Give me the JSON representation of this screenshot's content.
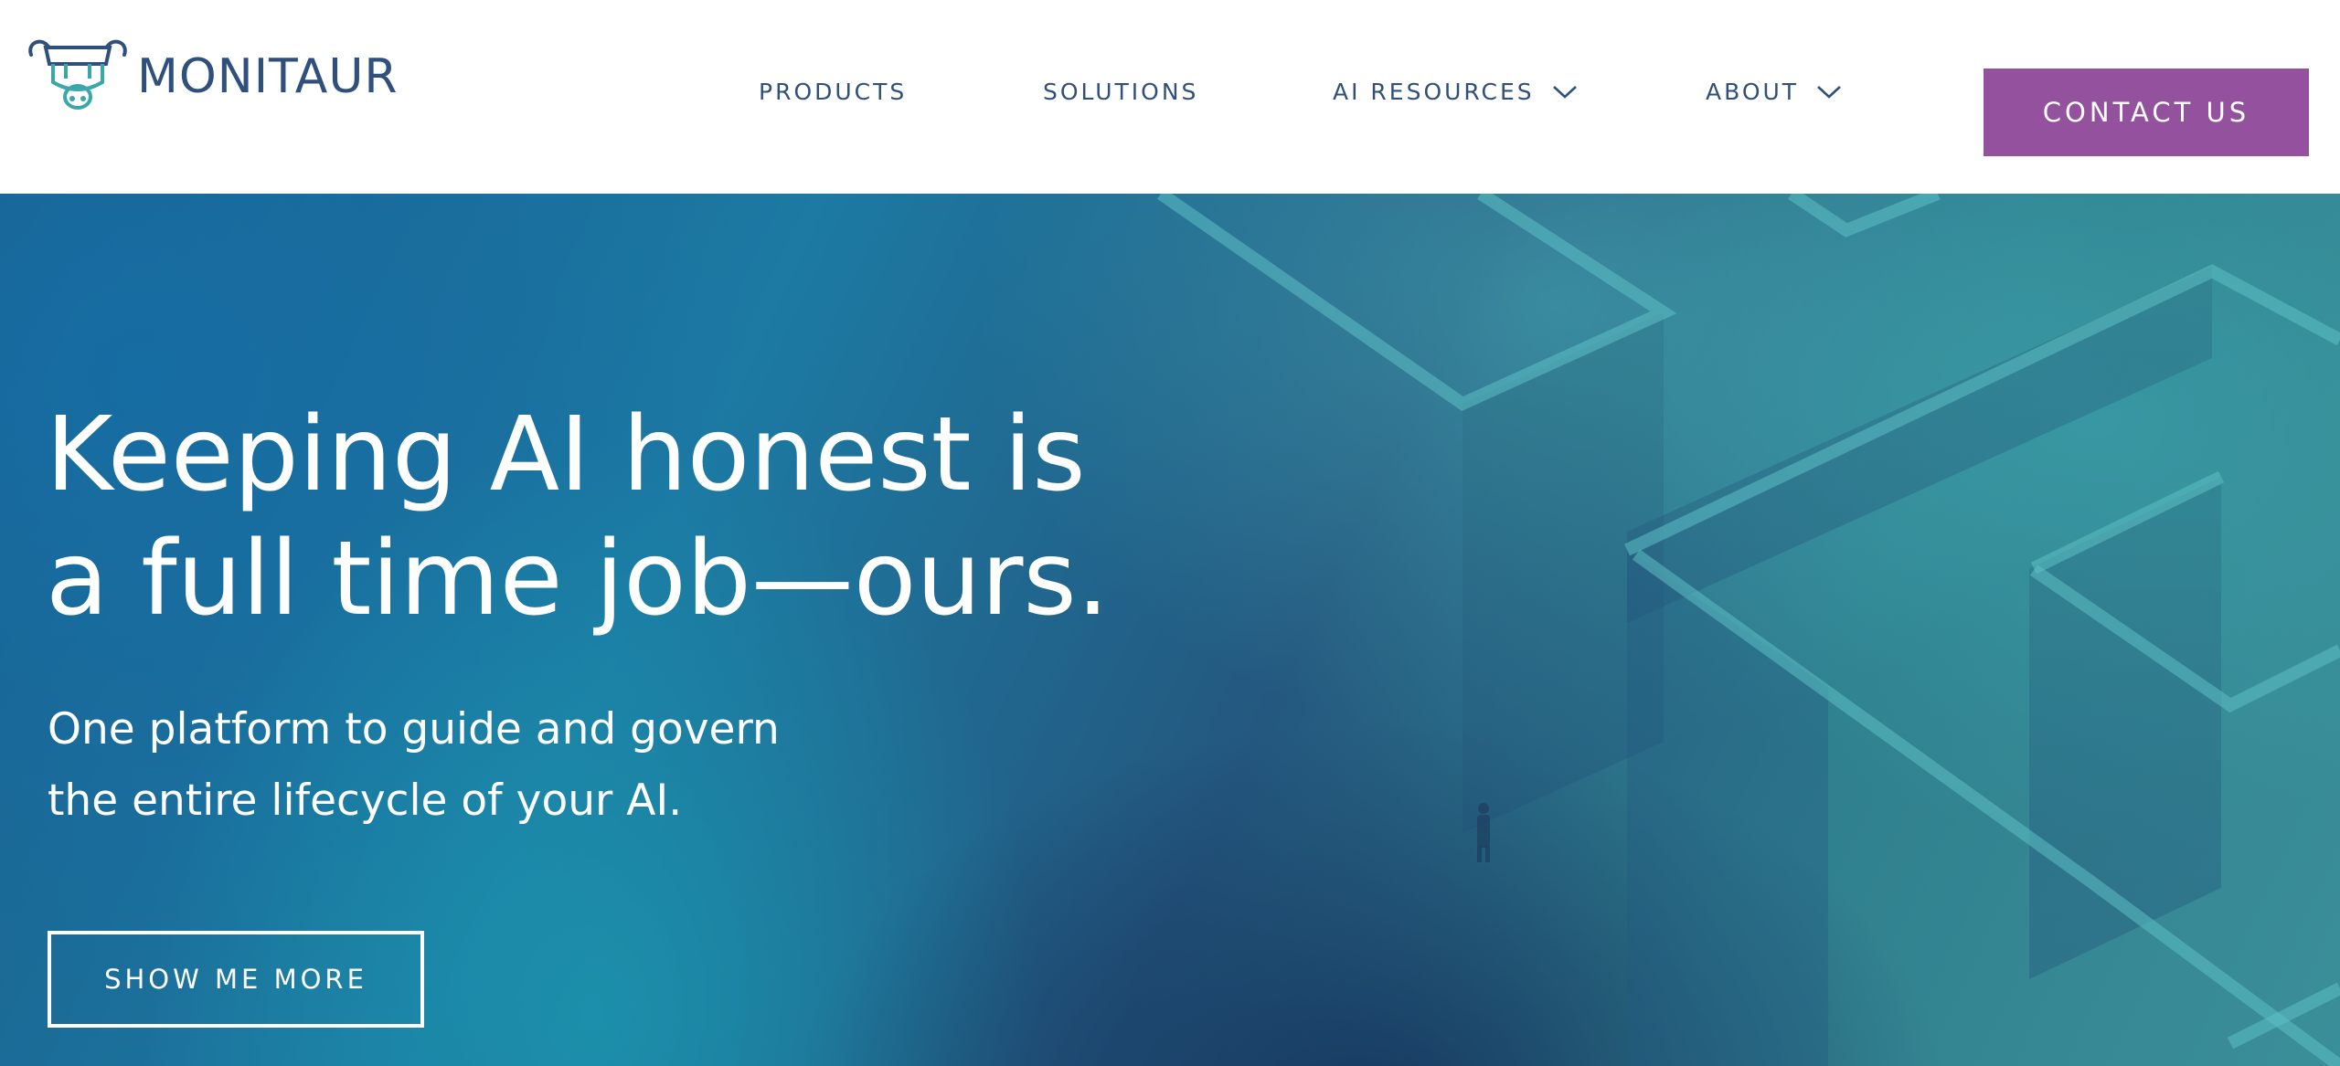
{
  "header": {
    "logo_text": "MONITAUR",
    "logo_icon": "bull-head-logo-icon",
    "nav": [
      {
        "label": "PRODUCTS",
        "has_dropdown": false
      },
      {
        "label": "SOLUTIONS",
        "has_dropdown": false
      },
      {
        "label": "AI RESOURCES",
        "has_dropdown": true
      },
      {
        "label": "ABOUT",
        "has_dropdown": true
      }
    ],
    "contact_label": "CONTACT US"
  },
  "hero": {
    "title_line1": "Keeping AI honest is",
    "title_line2": "a full time job—ours.",
    "subtitle_line1": "One platform to guide and govern",
    "subtitle_line2": "the entire lifecycle of your AI.",
    "cta_label": "SHOW ME MORE"
  },
  "colors": {
    "brand_navy": "#2f4f7c",
    "brand_teal": "#3aa8a8",
    "contact_purple": "#94519e",
    "hero_blue": "#1c7aa3",
    "hero_teal": "#3b8f99"
  }
}
